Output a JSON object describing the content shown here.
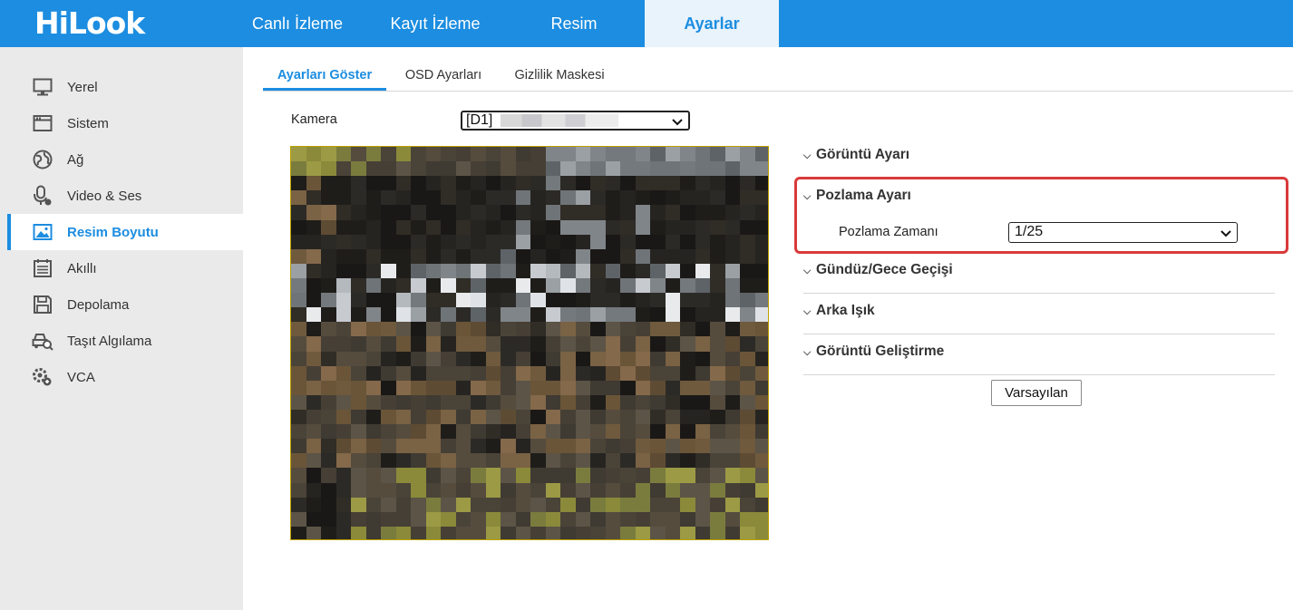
{
  "brand": {
    "logo_text": "HiLook"
  },
  "topnav": [
    {
      "label": "Canlı İzleme"
    },
    {
      "label": "Kayıt İzleme"
    },
    {
      "label": "Resim"
    },
    {
      "label": "Ayarlar",
      "active": true
    }
  ],
  "sidebar": {
    "items": [
      {
        "label": "Yerel",
        "icon": "monitor-icon"
      },
      {
        "label": "Sistem",
        "icon": "window-icon"
      },
      {
        "label": "Ağ",
        "icon": "globe-icon"
      },
      {
        "label": "Video & Ses",
        "icon": "mic-icon"
      },
      {
        "label": "Resim Boyutu",
        "icon": "image-icon",
        "active": true
      },
      {
        "label": "Akıllı",
        "icon": "list-icon"
      },
      {
        "label": "Depolama",
        "icon": "floppy-icon"
      },
      {
        "label": "Taşıt Algılama",
        "icon": "vehicle-search-icon"
      },
      {
        "label": "VCA",
        "icon": "vca-gear-icon"
      }
    ]
  },
  "subtabs": [
    {
      "label": "Ayarları Göster",
      "active": true
    },
    {
      "label": "OSD Ayarları"
    },
    {
      "label": "Gizlilik Maskesi"
    }
  ],
  "camera": {
    "label": "Kamera",
    "selected": "[D1]"
  },
  "settings": {
    "image_settings": "Görüntü Ayarı",
    "exposure": {
      "title": "Pozlama Ayarı",
      "time_label": "Pozlama Zamanı",
      "time_value": "1/25"
    },
    "day_night": "Gündüz/Gece Geçişi",
    "backlight": "Arka Işık",
    "enhancement": "Görüntü Geliştirme",
    "default_button": "Varsayılan"
  },
  "colors": {
    "accent": "#1c8de0",
    "highlight": "#d93a3a",
    "sidebar_bg": "#eaeaea"
  }
}
